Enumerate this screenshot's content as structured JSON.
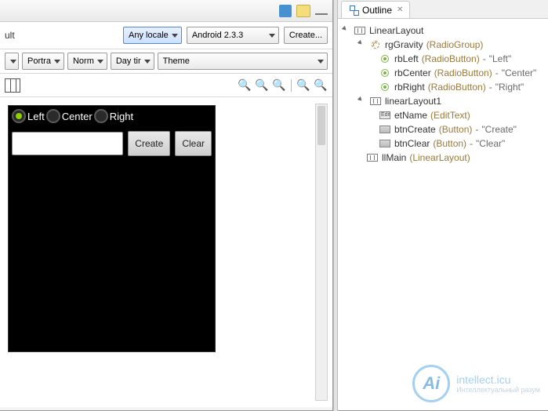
{
  "toolbar": {
    "ult_label": "ult",
    "locale_combo": "Any locale",
    "platform_combo": "Android 2.3.3",
    "create_btn": "Create..."
  },
  "row2": {
    "orient": "Portra",
    "norm": "Norm",
    "daytime": "Day tir",
    "theme": "Theme"
  },
  "zoom": {
    "reset": "⟲",
    "fit": "⊡",
    "in": "+",
    "out": "−"
  },
  "device": {
    "rb_left": "Left",
    "rb_center": "Center",
    "rb_right": "Right",
    "btn_create": "Create",
    "btn_clear": "Clear"
  },
  "outline": {
    "tab_label": "Outline",
    "tree": {
      "root": "LinearLayout",
      "rgGravity": {
        "name": "rgGravity",
        "type": "(RadioGroup)"
      },
      "rbLeft": {
        "name": "rbLeft",
        "type": "(RadioButton)",
        "text": "\"Left\""
      },
      "rbCenter": {
        "name": "rbCenter",
        "type": "(RadioButton)",
        "text": "\"Center\""
      },
      "rbRight": {
        "name": "rbRight",
        "type": "(RadioButton)",
        "text": "\"Right\""
      },
      "ll1": {
        "name": "linearLayout1"
      },
      "etName": {
        "name": "etName",
        "type": "(EditText)"
      },
      "btnCreate": {
        "name": "btnCreate",
        "type": "(Button)",
        "text": "\"Create\""
      },
      "btnClear": {
        "name": "btnClear",
        "type": "(Button)",
        "text": "\"Clear\""
      },
      "llMain": {
        "name": "llMain",
        "type": "(LinearLayout)"
      }
    }
  },
  "watermark": {
    "logo": "Ai",
    "title": "intellect.icu",
    "sub": "Интеллектуальный разум"
  }
}
